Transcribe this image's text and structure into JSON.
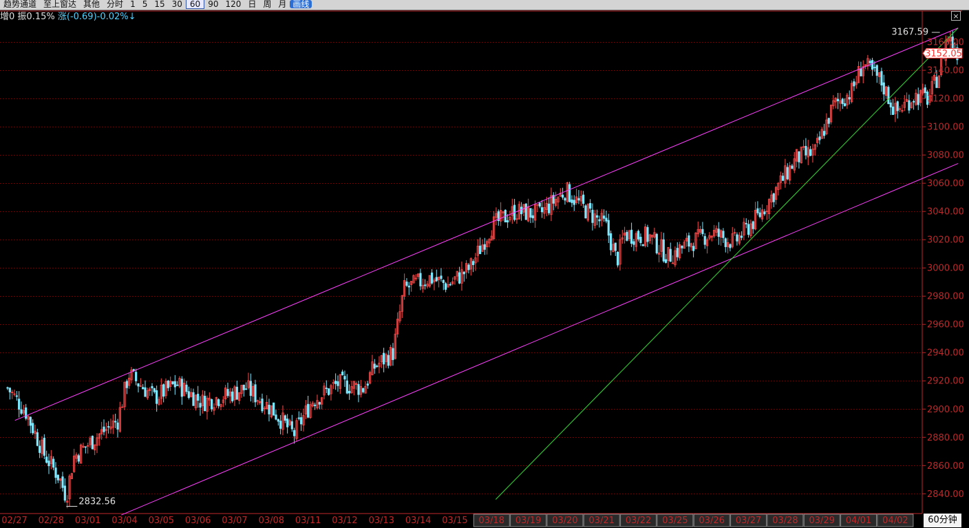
{
  "toolbar": {
    "items": [
      "趋势通道",
      "至上窗达",
      "其他",
      "分时",
      "1",
      "5",
      "15",
      "30",
      "60",
      "90",
      "120",
      "日",
      "周",
      "月"
    ],
    "selected": "60",
    "badge": "画线"
  },
  "info": {
    "increase_label": "增0",
    "amplitude_label": "振0.15%",
    "change_label": "涨(-0.69)-0.02%↓"
  },
  "close_glyph": "×",
  "period_label": "60分钟",
  "colors": {
    "up": "#ff4a4a",
    "down": "#7ee8ff",
    "grid": "#7a0000",
    "axis": "#c0282a",
    "channel": "#ff40ff",
    "trendline": "#33dd33",
    "current_price": "#ff3030"
  },
  "chart_data": {
    "type": "candlestick",
    "ylim": [
      2826,
      3182
    ],
    "y_ticks": [
      2840,
      2860,
      2880,
      2900,
      2920,
      2940,
      2960,
      2980,
      3000,
      3020,
      3040,
      3060,
      3080,
      3100,
      3120,
      3140,
      3160
    ],
    "dates": [
      "02/27",
      "02/28",
      "03/01",
      "03/04",
      "03/05",
      "03/06",
      "03/07",
      "03/08",
      "03/11",
      "03/12",
      "03/13",
      "03/14",
      "03/15",
      "03/18",
      "03/19",
      "03/20",
      "03/21",
      "03/22",
      "03/25",
      "03/26",
      "03/27",
      "03/28",
      "03/29",
      "04/01",
      "04/02"
    ],
    "highlighted_dates": [
      "03/18",
      "03/19",
      "03/20",
      "03/21",
      "03/22",
      "03/25",
      "03/26",
      "03/27",
      "03/28",
      "03/29",
      "04/01",
      "04/02"
    ],
    "path": [
      [
        0,
        2915
      ],
      [
        0.5,
        2898
      ],
      [
        1.0,
        2868
      ],
      [
        1.4,
        2852
      ],
      [
        1.6,
        2838
      ],
      [
        1.8,
        2866
      ],
      [
        2.5,
        2882
      ],
      [
        3.0,
        2892
      ],
      [
        3.3,
        2925
      ],
      [
        4.0,
        2908
      ],
      [
        4.6,
        2918
      ],
      [
        5.3,
        2905
      ],
      [
        6.0,
        2910
      ],
      [
        6.5,
        2915
      ],
      [
        7.2,
        2900
      ],
      [
        7.8,
        2882
      ],
      [
        8.3,
        2906
      ],
      [
        9.0,
        2918
      ],
      [
        9.7,
        2915
      ],
      [
        10.0,
        2930
      ],
      [
        10.5,
        2940
      ],
      [
        10.8,
        2985
      ],
      [
        11.5,
        2993
      ],
      [
        12.0,
        2988
      ],
      [
        12.6,
        3000
      ],
      [
        13.2,
        3030
      ],
      [
        13.8,
        3040
      ],
      [
        14.5,
        3038
      ],
      [
        15.2,
        3055
      ],
      [
        15.8,
        3040
      ],
      [
        16.3,
        3030
      ],
      [
        16.6,
        3005
      ],
      [
        16.8,
        3024
      ],
      [
        17.5,
        3022
      ],
      [
        18.0,
        3008
      ],
      [
        18.6,
        3018
      ],
      [
        19.2,
        3025
      ],
      [
        19.8,
        3018
      ],
      [
        20.5,
        3038
      ],
      [
        21.0,
        3058
      ],
      [
        21.5,
        3078
      ],
      [
        22.0,
        3082
      ],
      [
        22.5,
        3115
      ],
      [
        23.0,
        3125
      ],
      [
        23.3,
        3145
      ],
      [
        23.8,
        3132
      ],
      [
        24.2,
        3110
      ],
      [
        24.7,
        3122
      ],
      [
        25.1,
        3120
      ],
      [
        25.4,
        3140
      ],
      [
        25.6,
        3165
      ],
      [
        25.9,
        3152
      ]
    ],
    "channel_upper": [
      [
        0.2,
        2892
      ],
      [
        25.9,
        3170
      ]
    ],
    "channel_lower": [
      [
        3.1,
        2825
      ],
      [
        25.9,
        3074
      ]
    ],
    "trendline": [
      [
        13.3,
        2836
      ],
      [
        25.9,
        3170
      ]
    ],
    "annotations": {
      "high": {
        "value": "3167.59",
        "x": 25.6,
        "y": 3167.59
      },
      "low": {
        "value": "2832.56",
        "x": 1.6,
        "y": 2832.56
      }
    },
    "current_price": {
      "value": "3152.05",
      "y": 3152.05
    }
  }
}
